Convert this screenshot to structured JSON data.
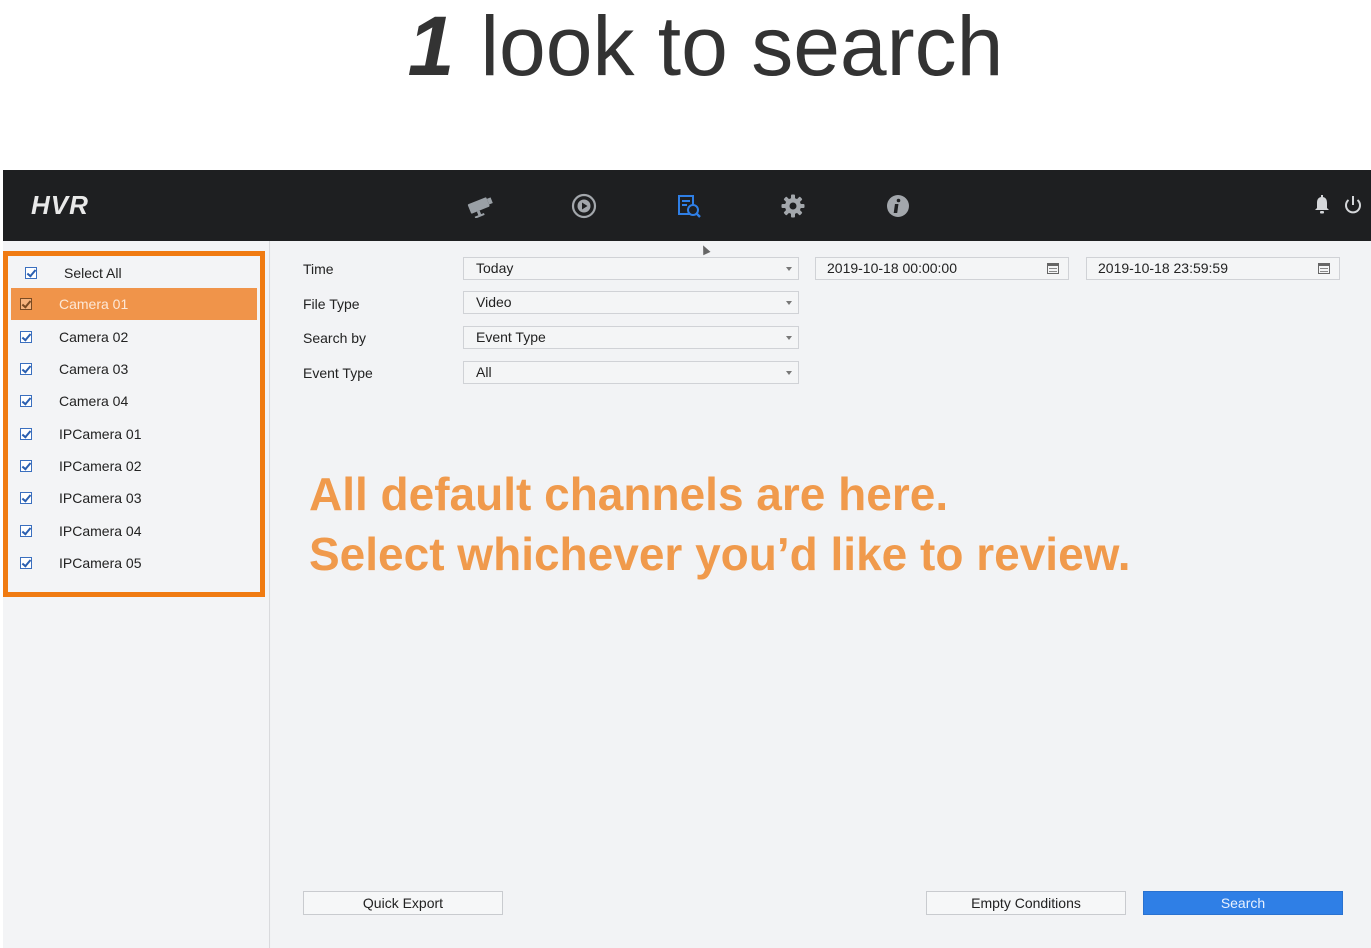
{
  "hero": {
    "step": "1",
    "title": "look to search"
  },
  "topbar": {
    "logo": "HVR",
    "nav": [
      {
        "icon": "camera-icon",
        "label": "Live View"
      },
      {
        "icon": "playback-icon",
        "label": "Playback"
      },
      {
        "icon": "search-icon",
        "label": "Search",
        "active": true
      },
      {
        "icon": "gear-icon",
        "label": "Configuration"
      },
      {
        "icon": "info-icon",
        "label": "Information"
      }
    ],
    "right_icons": [
      "bell-icon",
      "power-icon"
    ],
    "active_color": "#2f7fe6"
  },
  "sidebar": {
    "select_all": "Select All",
    "channels": [
      "Camera 01",
      "Camera 02",
      "Camera 03",
      "Camera 04",
      "IPCamera 01",
      "IPCamera 02",
      "IPCamera 03",
      "IPCamera 04",
      "IPCamera 05"
    ],
    "selected_channel": "Camera 01",
    "highlight_color": "#f07b12"
  },
  "form": {
    "time_label": "Time",
    "time_value": "Today",
    "start_datetime": "2019-10-18 00:00:00",
    "end_datetime": "2019-10-18 23:59:59",
    "file_type_label": "File Type",
    "file_type_value": "Video",
    "search_by_label": "Search by",
    "search_by_value": "Event Type",
    "event_type_label": "Event Type",
    "event_type_value": "All"
  },
  "annotation": {
    "line1": "All default channels are here.",
    "line2": "Select whichever you’d like to review.",
    "color": "#f09a4c"
  },
  "buttons": {
    "quick_export": "Quick Export",
    "empty_conditions": "Empty Conditions",
    "search": "Search"
  }
}
